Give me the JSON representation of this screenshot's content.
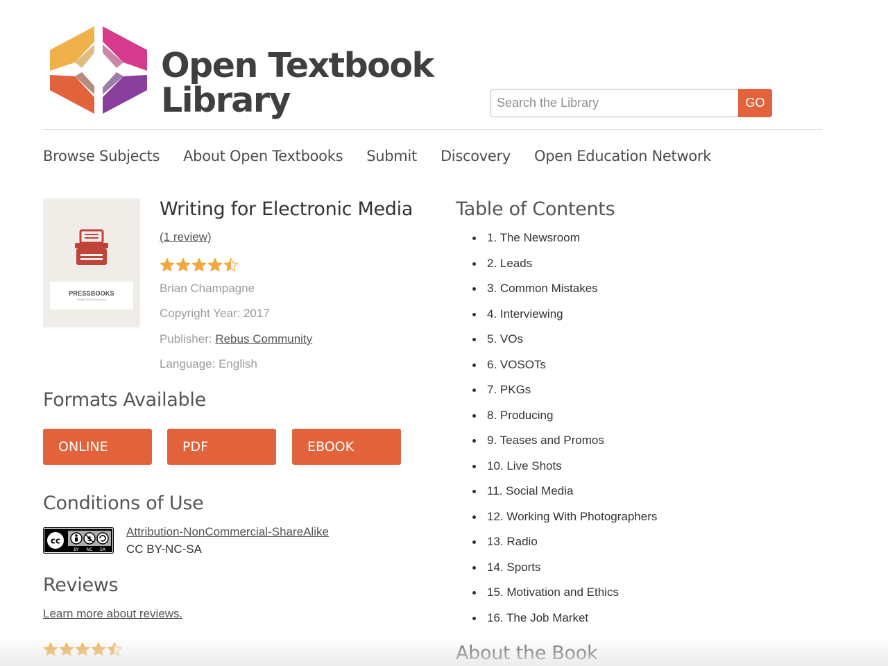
{
  "brand": {
    "line1": "Open Textbook",
    "line2": "Library",
    "colors": {
      "orange": "#e2623b",
      "pink": "#d63a8c",
      "purple": "#8a3f9c",
      "yellow": "#f0b04a"
    }
  },
  "search": {
    "placeholder": "Search the Library",
    "button_label": "GO"
  },
  "nav": {
    "items": [
      {
        "label": "Browse Subjects"
      },
      {
        "label": "About Open Textbooks"
      },
      {
        "label": "Submit"
      },
      {
        "label": "Discovery"
      },
      {
        "label": "Open Education Network"
      }
    ]
  },
  "book": {
    "cover": {
      "title": "PRESSBOOKS",
      "subtitle": "Simple Book Production"
    },
    "title": "Writing for Electronic Media",
    "review_link": "(1 review)",
    "rating": 4.5,
    "author": "Brian Champagne",
    "copyright": "Copyright Year: 2017",
    "publisher_label": "Publisher: ",
    "publisher": "Rebus Community",
    "language": "Language: English"
  },
  "formats": {
    "heading": "Formats Available",
    "buttons": [
      {
        "label": "ONLINE"
      },
      {
        "label": "PDF"
      },
      {
        "label": "EBOOK"
      }
    ]
  },
  "conditions": {
    "heading": "Conditions of Use",
    "license_name": "Attribution-NonCommercial-ShareAlike",
    "license_code": "CC BY-NC-SA",
    "badge": {
      "cc": "cc",
      "by": "BY",
      "nc": "NC",
      "sa": "SA"
    }
  },
  "reviews": {
    "heading": "Reviews",
    "learn_more": "Learn more about reviews.",
    "rating": 4.5
  },
  "toc": {
    "heading": "Table of Contents",
    "items": [
      "1. The Newsroom",
      "2. Leads",
      "3. Common Mistakes",
      "4. Interviewing",
      "5. VOs",
      "6. VOSOTs",
      "7. PKGs",
      "8. Producing",
      "9. Teases and Promos",
      "10. Live Shots",
      "11. Social Media",
      "12. Working With Photographers",
      "13. Radio",
      "14. Sports",
      "15. Motivation and Ethics",
      "16. The Job Market"
    ]
  },
  "about": {
    "heading": "About the Book"
  }
}
